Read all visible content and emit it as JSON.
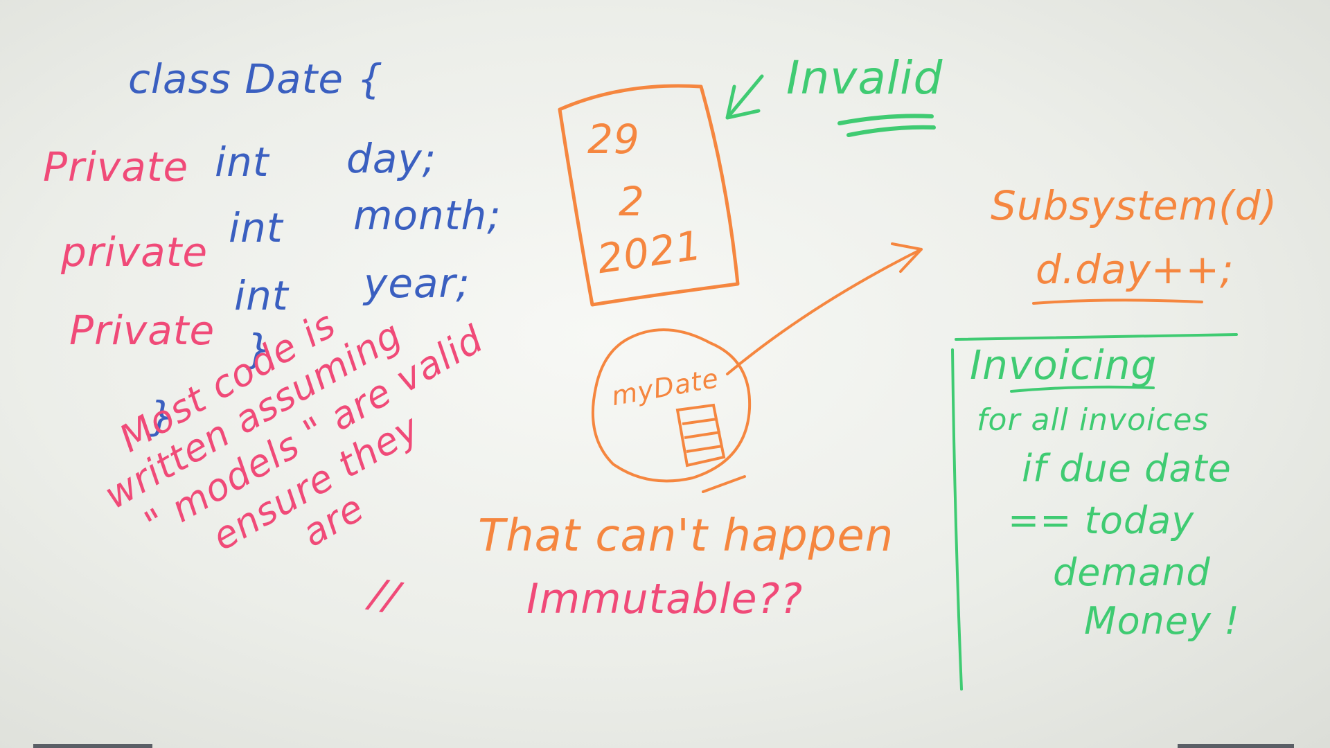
{
  "whiteboard": {
    "code": {
      "class_decl": "class Date {",
      "field_keyword": [
        "Private",
        "private",
        "Private"
      ],
      "field_type": [
        "int",
        "int",
        "int"
      ],
      "field_name": [
        "day;",
        "month;",
        "year;"
      ],
      "inner_brace": "}",
      "outer_brace": "}"
    },
    "note_left": {
      "lines": [
        "Most code is",
        "written assuming",
        "\" models \" are valid",
        "ensure they",
        "are"
      ],
      "slashes": "//"
    },
    "date_box": {
      "day": "29",
      "month": "2",
      "year": "2021"
    },
    "invalid_label": "Invalid",
    "object_label": "myDate",
    "subsystem": {
      "call": "Subsystem(d)",
      "statement": "d.day++;"
    },
    "center_text": {
      "line1": "That can't happen",
      "line2": "Immutable??"
    },
    "invoicing": {
      "title": "Invoicing",
      "lines": [
        "for all invoices",
        "if due date",
        "== today",
        "demand",
        "Money !"
      ]
    },
    "colors": {
      "blue_marker": "#3a5fc0",
      "pink_marker": "#f04a78",
      "orange_marker": "#f5863f",
      "green_marker": "#3fcb72"
    }
  }
}
